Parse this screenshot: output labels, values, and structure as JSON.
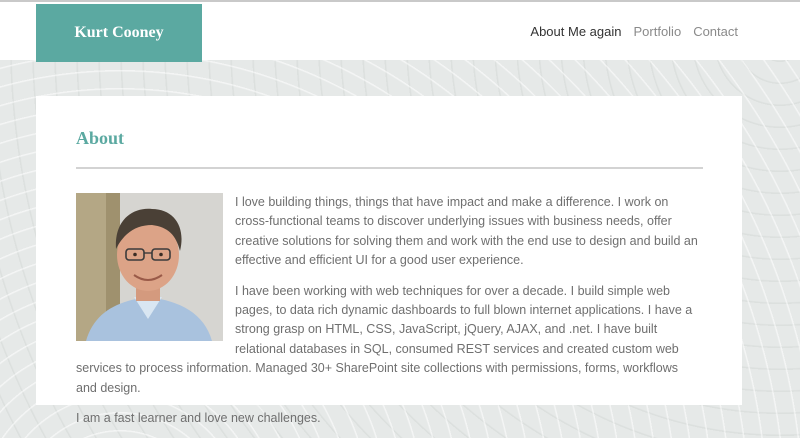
{
  "brand": {
    "name": "Kurt Cooney",
    "color": "#5ba9a1"
  },
  "nav": {
    "items": [
      {
        "label": "About Me again",
        "active": true
      },
      {
        "label": "Portfolio",
        "active": false
      },
      {
        "label": "Contact",
        "active": false
      }
    ]
  },
  "about": {
    "title": "About",
    "portrait_icon": "person-photo",
    "paragraphs": [
      "I love building things, things that have impact and make a difference. I work on cross-functional teams to discover underlying issues with business needs, offer creative solutions for solving them and work with the end use to design and build an effective and efficient UI for a good user experience.",
      "I have been working with web techniques for over a decade. I build simple web pages, to data rich dynamic dashboards to full blown internet applications. I have a strong grasp on HTML, CSS, JavaScript, jQuery, AJAX, and .net. I have built relational databases in SQL, consumed REST services and created custom web services to process information. Managed 30+ SharePoint site collections with permissions, forms, workflows and design.",
      "I am a fast learner and love new challenges."
    ]
  }
}
